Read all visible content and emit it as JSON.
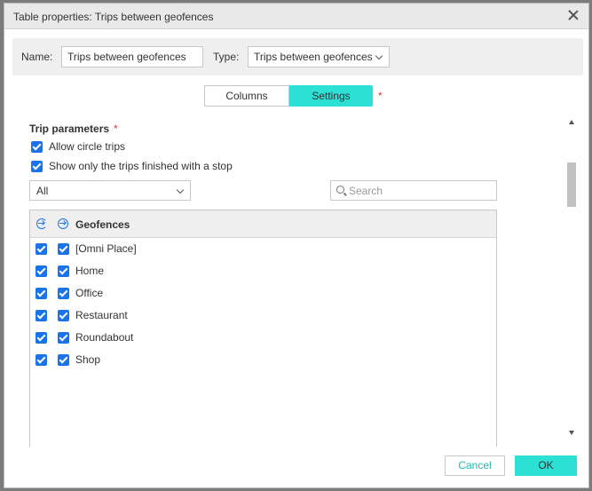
{
  "dialog": {
    "title": "Table properties: Trips between geofences"
  },
  "header": {
    "name_label": "Name:",
    "name_value": "Trips between geofences",
    "type_label": "Type:",
    "type_value": "Trips between geofences"
  },
  "tabs": [
    {
      "label": "Columns",
      "active": false
    },
    {
      "label": "Settings",
      "active": true
    }
  ],
  "required_marker": "*",
  "trip_parameters": {
    "title": "Trip parameters",
    "options": [
      {
        "label": "Allow circle trips",
        "checked": true
      },
      {
        "label": "Show only the trips finished with a stop",
        "checked": true
      }
    ]
  },
  "filter": {
    "selected": "All"
  },
  "search": {
    "placeholder": "Search",
    "value": ""
  },
  "geofences": {
    "title": "Geofences",
    "header_icons": [
      "geofence-exit-icon",
      "geofence-enter-icon"
    ],
    "items": [
      {
        "name": "[Omni Place]",
        "exit": true,
        "enter": true
      },
      {
        "name": "Home",
        "exit": true,
        "enter": true
      },
      {
        "name": "Office",
        "exit": true,
        "enter": true
      },
      {
        "name": "Restaurant",
        "exit": true,
        "enter": true
      },
      {
        "name": "Roundabout",
        "exit": true,
        "enter": true
      },
      {
        "name": "Shop",
        "exit": true,
        "enter": true
      }
    ]
  },
  "buttons": {
    "cancel": "Cancel",
    "ok": "OK"
  },
  "colors": {
    "accent": "#2de0d6",
    "checkbox": "#1a73e8",
    "required": "#e53935",
    "cancel_text": "#20b8ae"
  }
}
